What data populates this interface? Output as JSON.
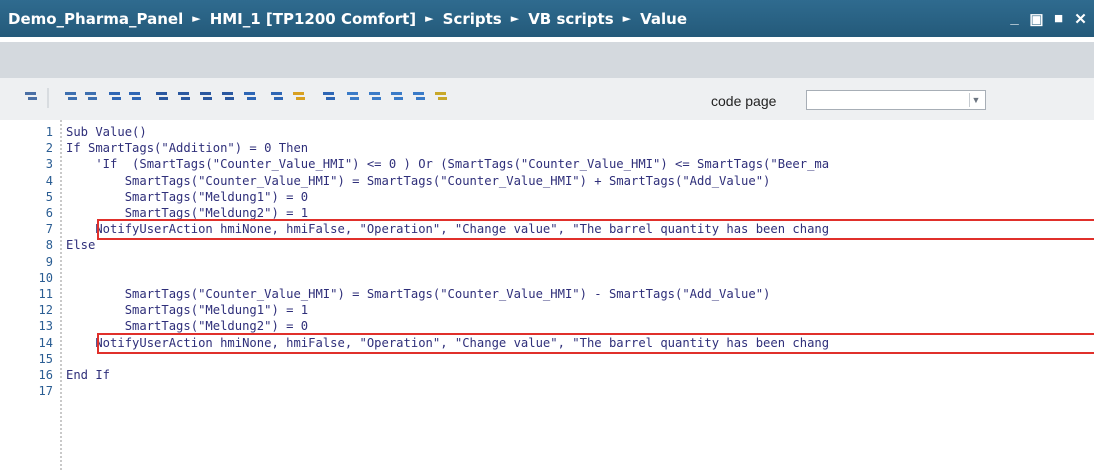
{
  "window": {
    "breadcrumb": [
      "Demo_Pharma_Panel",
      "HMI_1 [TP1200 Comfort]",
      "Scripts",
      "VB scripts",
      "Value"
    ],
    "separator": "►",
    "controls": [
      "_",
      "▣",
      "■",
      "✕"
    ]
  },
  "toolbar": {
    "icons": [
      "show-tag-icon",
      "indent-icon",
      "outdent-icon",
      "comment-icon",
      "uncomment-icon",
      "bookmark-toggle-icon",
      "bookmark-prev-icon",
      "bookmark-next-icon",
      "bookmark-clear-icon",
      "goto-line-icon",
      "syntax-check-icon",
      "breakpoint-icon",
      "snippet-icon",
      "library-icon",
      "insert-1-icon",
      "insert-2-icon",
      "insert-3-icon",
      "insert-4-icon"
    ],
    "code_page_label": "code page",
    "code_page_value": ""
  },
  "editor": {
    "lines": [
      {
        "n": "1",
        "text": "Sub Value()"
      },
      {
        "n": "2",
        "text": "If SmartTags(\"Addition\") = 0 Then"
      },
      {
        "n": "3",
        "text": "    'If  (SmartTags(\"Counter_Value_HMI\") <= 0 ) Or (SmartTags(\"Counter_Value_HMI\") <= SmartTags(\"Beer_ma"
      },
      {
        "n": "4",
        "text": "        SmartTags(\"Counter_Value_HMI\") = SmartTags(\"Counter_Value_HMI\") + SmartTags(\"Add_Value\")"
      },
      {
        "n": "5",
        "text": "        SmartTags(\"Meldung1\") = 0"
      },
      {
        "n": "6",
        "text": "        SmartTags(\"Meldung2\") = 1"
      },
      {
        "n": "7",
        "text": "    NotifyUserAction hmiNone, hmiFalse, \"Operation\", \"Change value\", \"The barrel quantity has been chang"
      },
      {
        "n": "8",
        "text": "Else"
      },
      {
        "n": "9",
        "text": ""
      },
      {
        "n": "10",
        "text": ""
      },
      {
        "n": "11",
        "text": "        SmartTags(\"Counter_Value_HMI\") = SmartTags(\"Counter_Value_HMI\") - SmartTags(\"Add_Value\")"
      },
      {
        "n": "12",
        "text": "        SmartTags(\"Meldung1\") = 1"
      },
      {
        "n": "13",
        "text": "        SmartTags(\"Meldung2\") = 0"
      },
      {
        "n": "14",
        "text": "    NotifyUserAction hmiNone, hmiFalse, \"Operation\", \"Change value\", \"The barrel quantity has been chang"
      },
      {
        "n": "15",
        "text": ""
      },
      {
        "n": "16",
        "text": "End If"
      },
      {
        "n": "17",
        "text": ""
      }
    ],
    "highlighted_lines": [
      "7",
      "14"
    ],
    "highlight_color": "#e0302b"
  }
}
